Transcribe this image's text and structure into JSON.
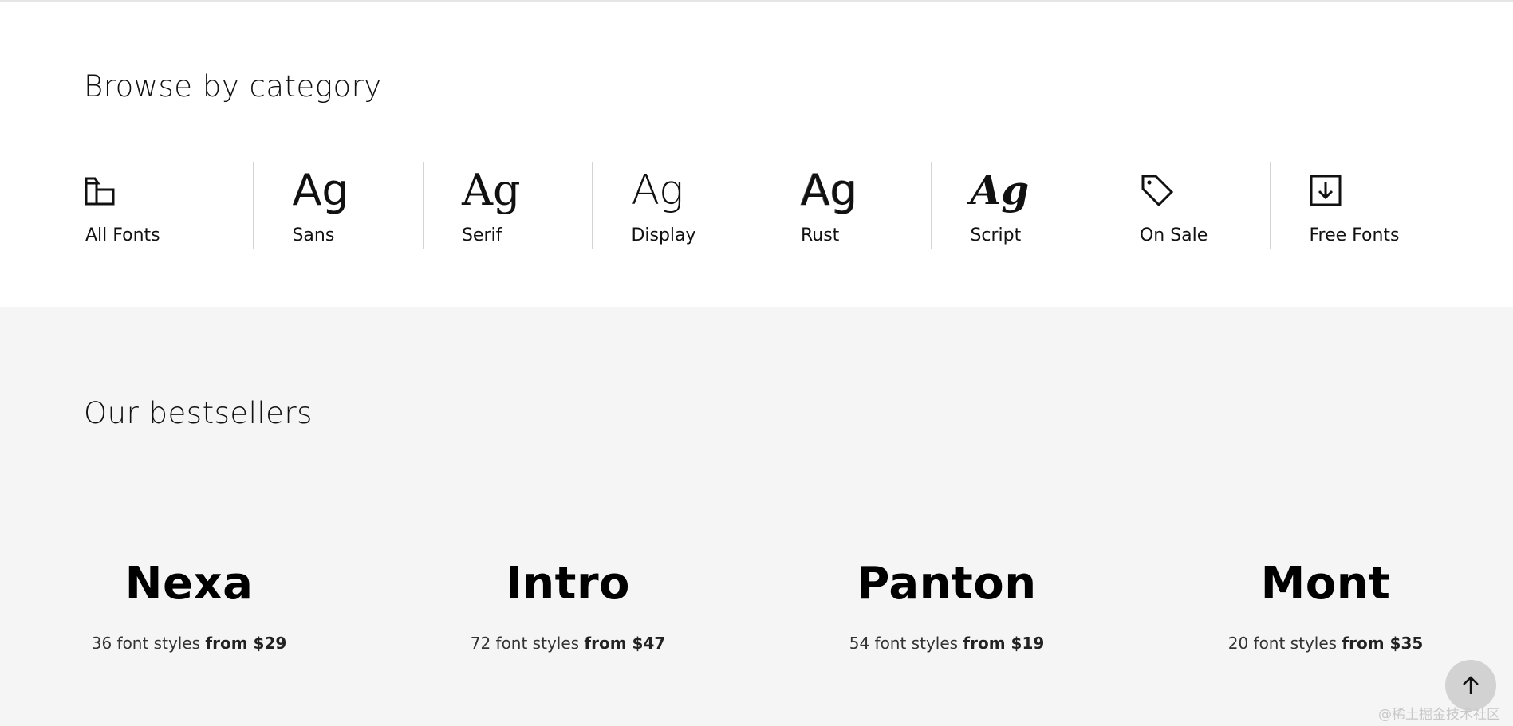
{
  "browse": {
    "title": "Browse by category",
    "categories": [
      {
        "label": "All Fonts",
        "icon": "folder-icon"
      },
      {
        "label": "Sans",
        "icon": "ag-sans-icon",
        "glyph": "Ag"
      },
      {
        "label": "Serif",
        "icon": "ag-serif-icon",
        "glyph": "Ag"
      },
      {
        "label": "Display",
        "icon": "ag-display-icon",
        "glyph": "Ag"
      },
      {
        "label": "Rust",
        "icon": "ag-rust-icon",
        "glyph": "Ag"
      },
      {
        "label": "Script",
        "icon": "ag-script-icon",
        "glyph": "Ag"
      },
      {
        "label": "On Sale",
        "icon": "tag-icon"
      },
      {
        "label": "Free Fonts",
        "icon": "download-icon"
      }
    ]
  },
  "bestsellers": {
    "title": "Our bestsellers",
    "products": [
      {
        "name": "Nexa",
        "styles": "36 font styles",
        "price": "from $29"
      },
      {
        "name": "Intro",
        "styles": "72 font styles",
        "price": "from $47"
      },
      {
        "name": "Panton",
        "styles": "54 font styles",
        "price": "from $19"
      },
      {
        "name": "Mont",
        "styles": "20 font styles",
        "price": "from $35"
      }
    ]
  },
  "scroll_top": {
    "icon": "arrow-up-icon"
  },
  "watermark": "@稀土掘金技术社区",
  "colors": {
    "page_bg": "#ffffff",
    "section_bg": "#f5f5f5",
    "text": "#111111",
    "divider": "#d4d4d4",
    "scroll_button": "#d2d2d2"
  }
}
